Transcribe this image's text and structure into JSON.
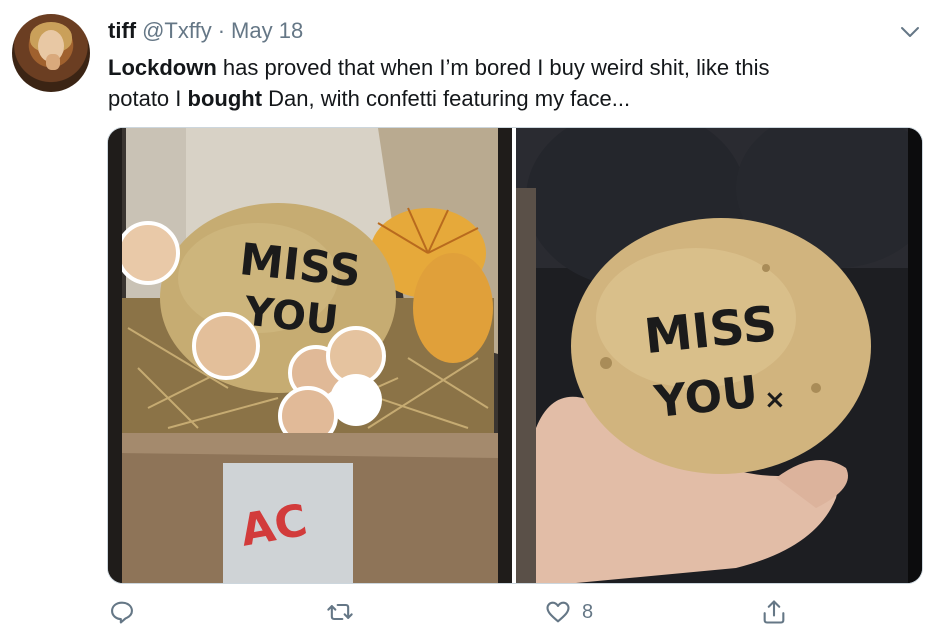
{
  "tweet": {
    "author_name": "tiff",
    "author_handle": "@Txffy",
    "separator": "·",
    "date": "May 18",
    "text_line1_bold1": "Lockdown",
    "text_line1_rest": " has proved that when I’m bored I buy weird shit, like this",
    "text_line2_start": "potato I ",
    "text_line2_bold": "bought",
    "text_line2_rest": " Dan, with confetti featuring my face...",
    "images": [
      {
        "caption_on_potato": [
          "MISS",
          "YOU"
        ]
      },
      {
        "caption_on_potato": [
          "MISS",
          "YOU",
          "×"
        ]
      }
    ],
    "like_count": "8"
  },
  "icons": {
    "reply": "reply-icon",
    "retweet": "retweet-icon",
    "like": "heart-icon",
    "share": "share-icon",
    "more": "chevron-down-icon"
  },
  "colors": {
    "text": "#14171a",
    "secondary": "#657786",
    "border": "#ccd6dd"
  }
}
